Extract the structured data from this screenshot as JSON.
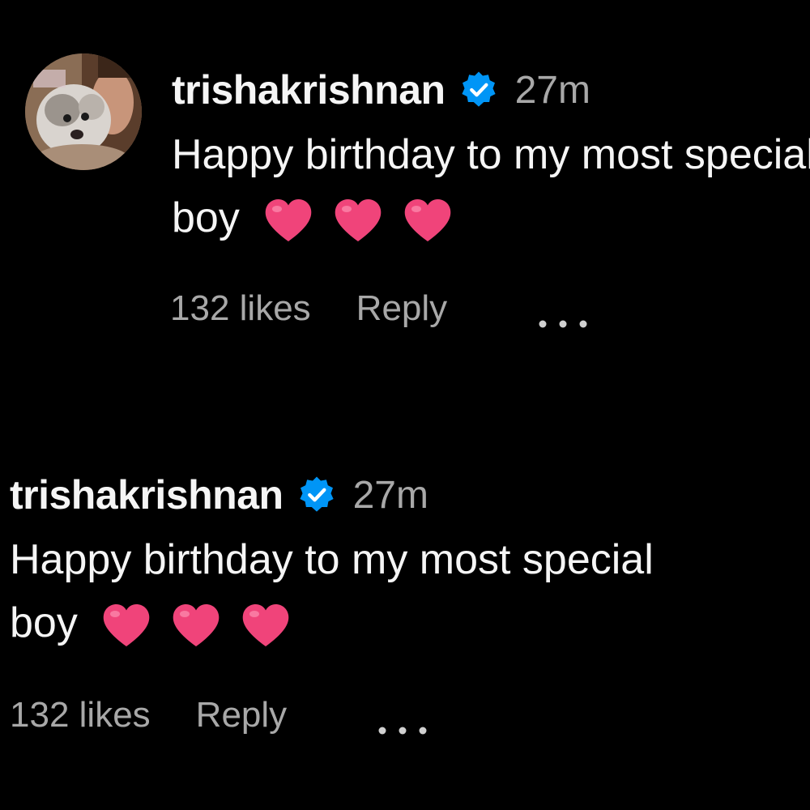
{
  "comments": [
    {
      "username": "trishakrishnan",
      "time": "27m",
      "text_line1": "Happy birthday to my most special",
      "text_line2": "boy",
      "likes": "132 likes",
      "reply_label": "Reply",
      "has_avatar": true
    },
    {
      "username": "trishakrishnan",
      "time": "27m",
      "text_line1": "Happy birthday to my most special",
      "text_line2": "boy",
      "likes": "132 likes",
      "reply_label": "Reply",
      "has_avatar": false
    }
  ],
  "icons": {
    "verified": "verified-badge-icon",
    "heart": "heart-icon",
    "more": "more-options-icon"
  },
  "colors": {
    "background": "#000000",
    "text": "#f5f5f5",
    "secondary": "#a8a8a8",
    "verified_blue": "#0095f6",
    "heart_pink": "#f0447a"
  }
}
